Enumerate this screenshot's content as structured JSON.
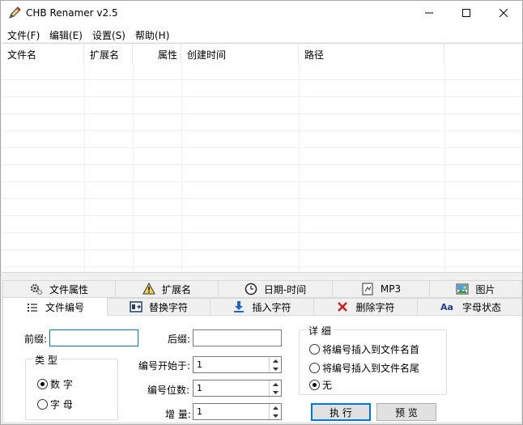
{
  "window": {
    "title": "CHB Renamer v2.5",
    "app_icon": "pencil-rename-icon",
    "controls": [
      "minimize-icon",
      "maximize-icon",
      "close-icon"
    ]
  },
  "menu": {
    "file": "文件(F)",
    "edit": "编辑(E)",
    "settings": "设置(S)",
    "help": "帮助(H)"
  },
  "filelist": {
    "columns": [
      "文件名",
      "扩展名",
      "属性",
      "创建时间",
      "路径"
    ],
    "rows": []
  },
  "tabs": {
    "row1": [
      {
        "label": "文件属性",
        "icon": "gears-icon"
      },
      {
        "label": "扩展名",
        "icon": "warning-icon"
      },
      {
        "label": "日期-时间",
        "icon": "clock-icon"
      },
      {
        "label": "MP3",
        "icon": "music-file-icon"
      },
      {
        "label": "图片",
        "icon": "picture-icon"
      }
    ],
    "row2": [
      {
        "label": "文件编号",
        "icon": "numbered-list-icon"
      },
      {
        "label": "替换字符",
        "icon": "replace-icon"
      },
      {
        "label": "插入字符",
        "icon": "insert-arrow-icon"
      },
      {
        "label": "删除字符",
        "icon": "delete-x-icon"
      },
      {
        "label": "字母状态",
        "icon": "font-case-icon",
        "icon_text": "Aa"
      }
    ],
    "active": "文件编号"
  },
  "numbering": {
    "prefix_label": "前缀:",
    "prefix_value": "",
    "suffix_label": "后缀:",
    "suffix_value": "",
    "type_group": "类 型",
    "type_options": [
      "数 字",
      "字 母"
    ],
    "type_selected": "数 字",
    "start_label": "编号开始于:",
    "start_value": "1",
    "digits_label": "编号位数:",
    "digits_value": "1",
    "increment_label": "增 量:",
    "increment_value": "1",
    "detail_group": "详 细",
    "detail_options": [
      "将编号插入到文件名首",
      "将编号插入到文件名尾",
      "无"
    ],
    "detail_selected": "无",
    "execute_button": "执 行",
    "preview_button": "预 览"
  }
}
